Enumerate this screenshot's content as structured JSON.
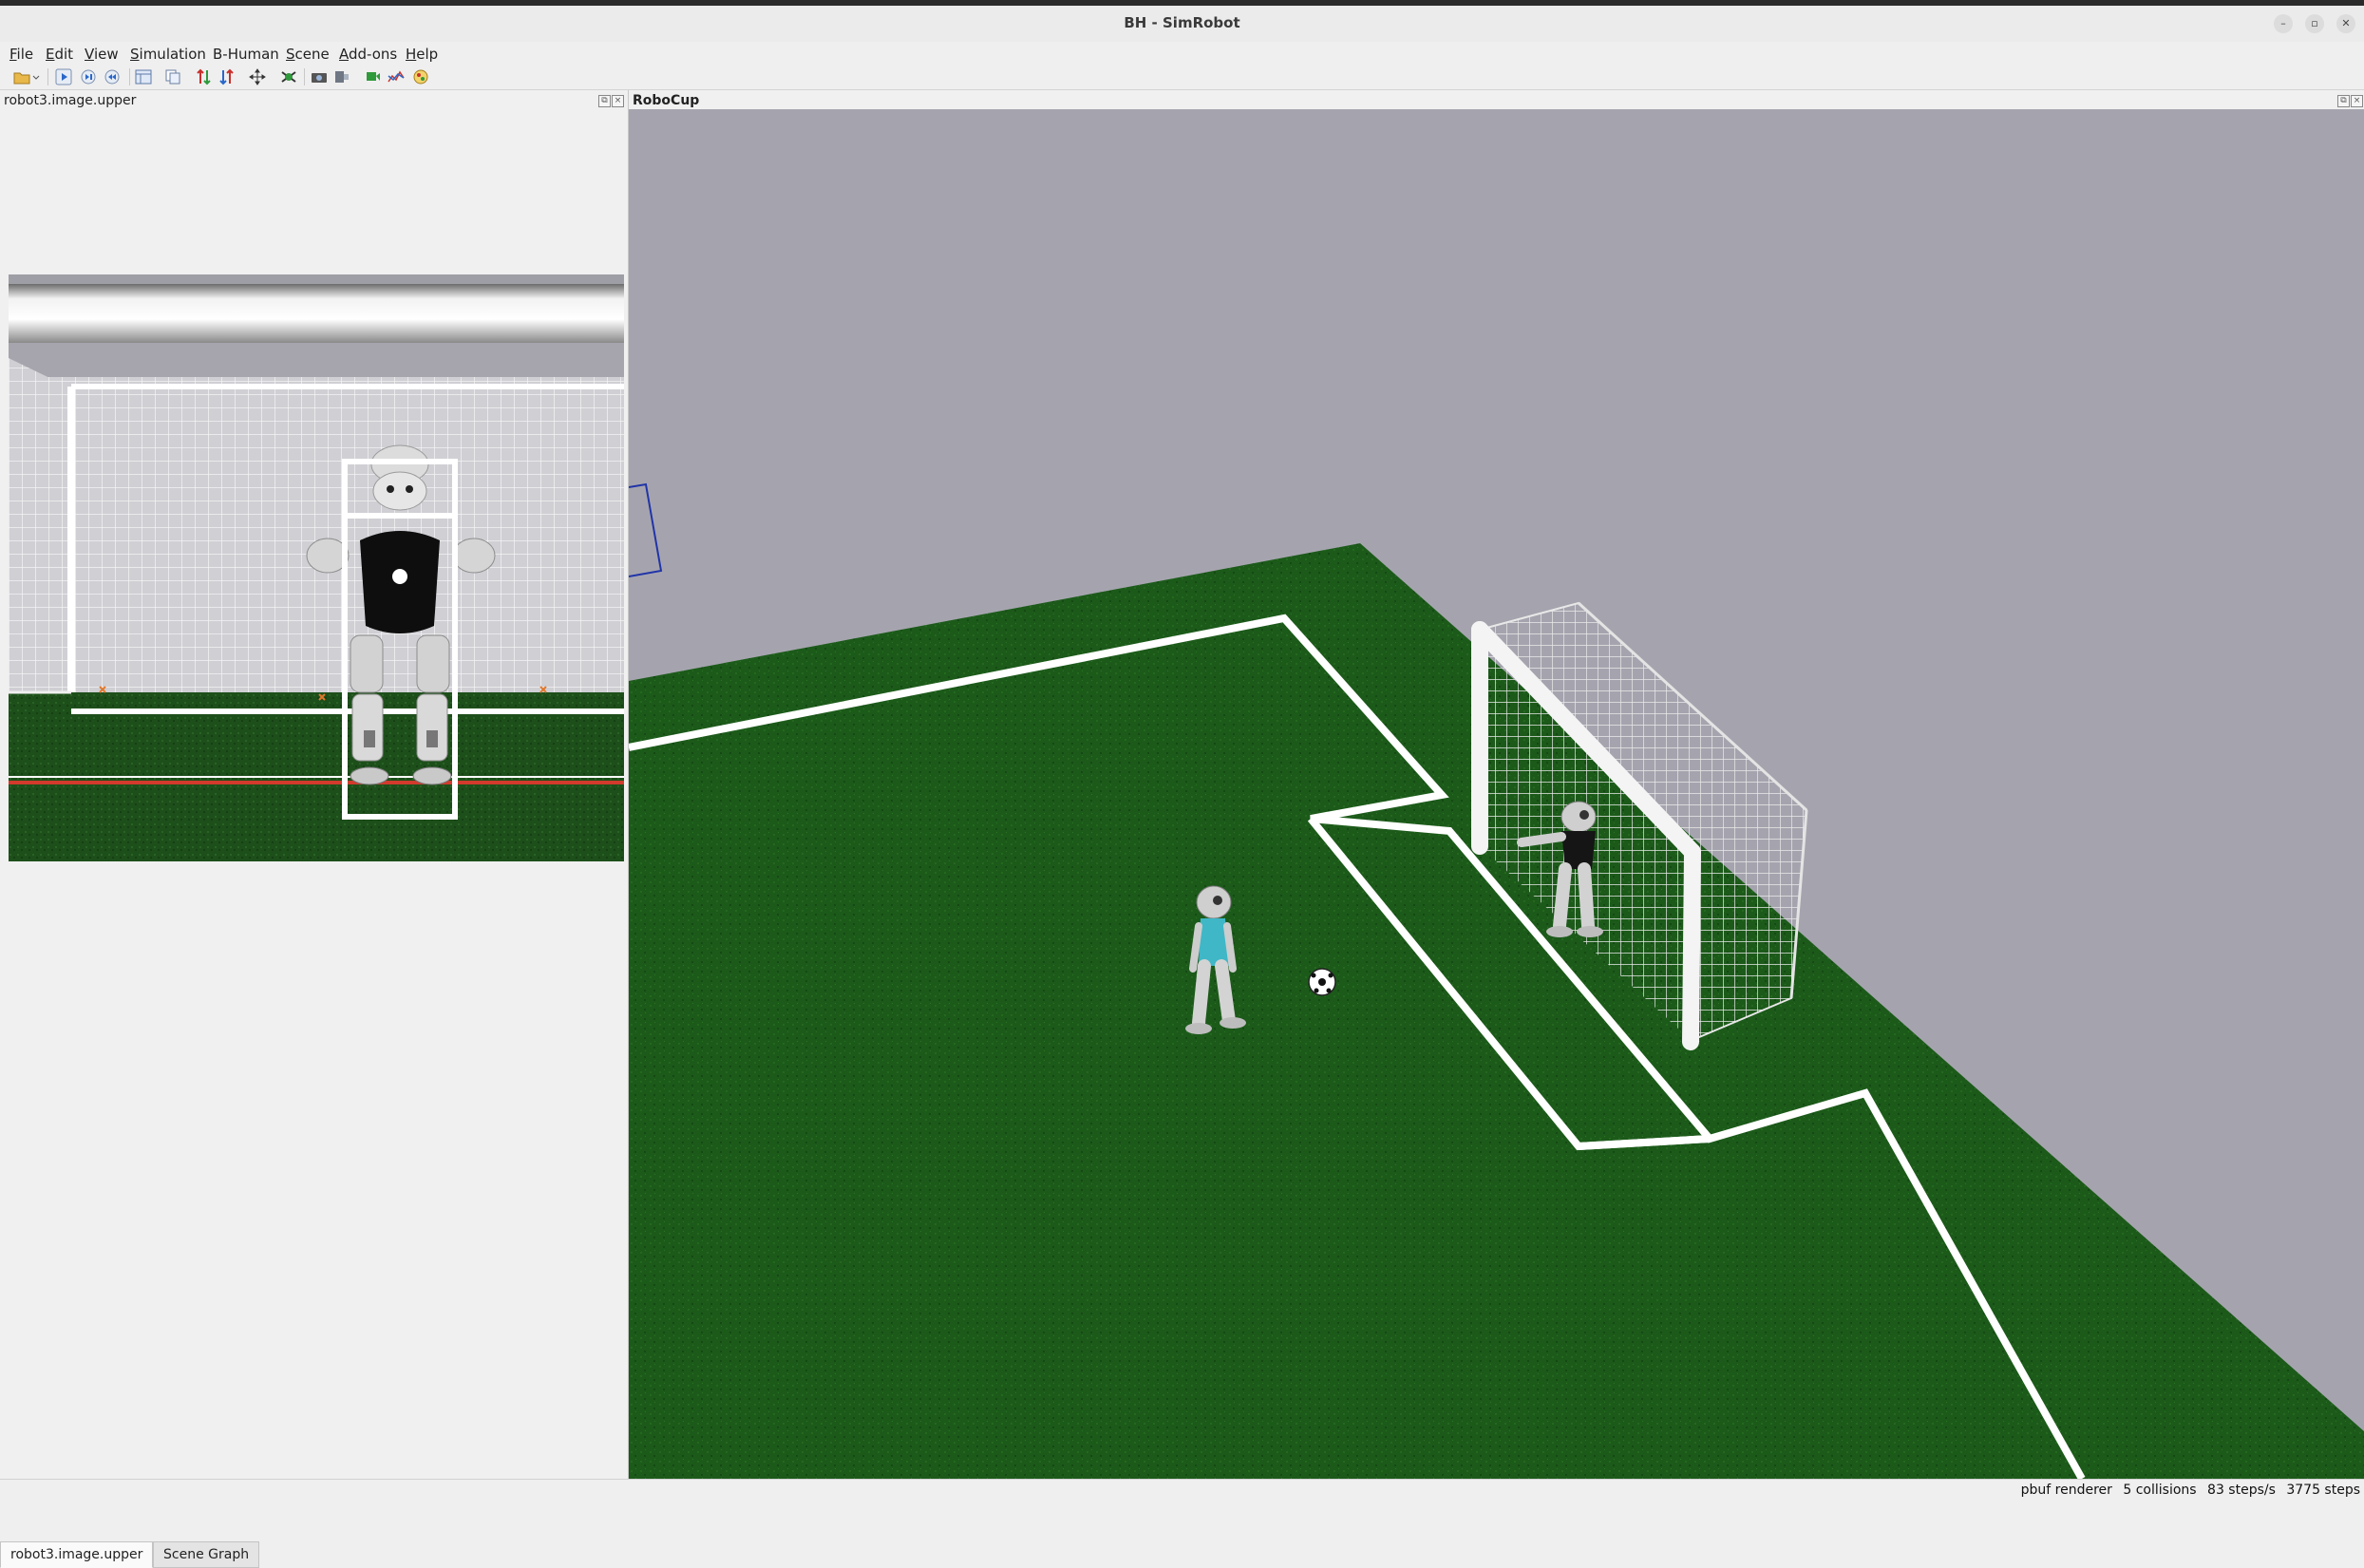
{
  "window": {
    "title": "BH - SimRobot",
    "controls": {
      "minimize": "–",
      "restore": "▫",
      "close": "✕"
    }
  },
  "menu": [
    {
      "mnemonic": "F",
      "rest": "ile"
    },
    {
      "mnemonic": "E",
      "rest": "dit"
    },
    {
      "mnemonic": "V",
      "rest": "iew"
    },
    {
      "mnemonic": "S",
      "rest": "imulation"
    },
    {
      "mnemonic": "",
      "rest": "B-Human"
    },
    {
      "mnemonic": "S",
      "rest": "cene"
    },
    {
      "mnemonic": "A",
      "rest": "dd-ons"
    },
    {
      "mnemonic": "H",
      "rest": "elp"
    }
  ],
  "toolbar": {
    "icons": [
      "open-icon",
      "start-icon",
      "step-icon",
      "reset-icon",
      "layout-icon",
      "copy-icon",
      "drag-mode-icon",
      "move-icon",
      "camera-icon",
      "sensor-icon",
      "graph-icon",
      "render-icon"
    ],
    "colors": {
      "accent_blue": "#2a67c9",
      "accent_red": "#c8302c",
      "accent_green": "#2f9a3c"
    }
  },
  "left_panel": {
    "title": "robot3.image.upper",
    "tabs": [
      {
        "label": "robot3.image.upper",
        "active": true
      },
      {
        "label": "Scene Graph",
        "active": false
      }
    ]
  },
  "right_panel": {
    "title": "RoboCup"
  },
  "scene": {
    "colors": {
      "sky": "#a5a4ae",
      "field": "#1c5a1a",
      "line": "#ffffff",
      "robot_body": "#d0d0d0",
      "team_jersey": "#3fb7c7",
      "goalie_jersey": "#111111"
    }
  },
  "status": {
    "renderer": "pbuf renderer",
    "collisions": "5 collisions",
    "rate": "83 steps/s",
    "steps": "3775 steps"
  }
}
